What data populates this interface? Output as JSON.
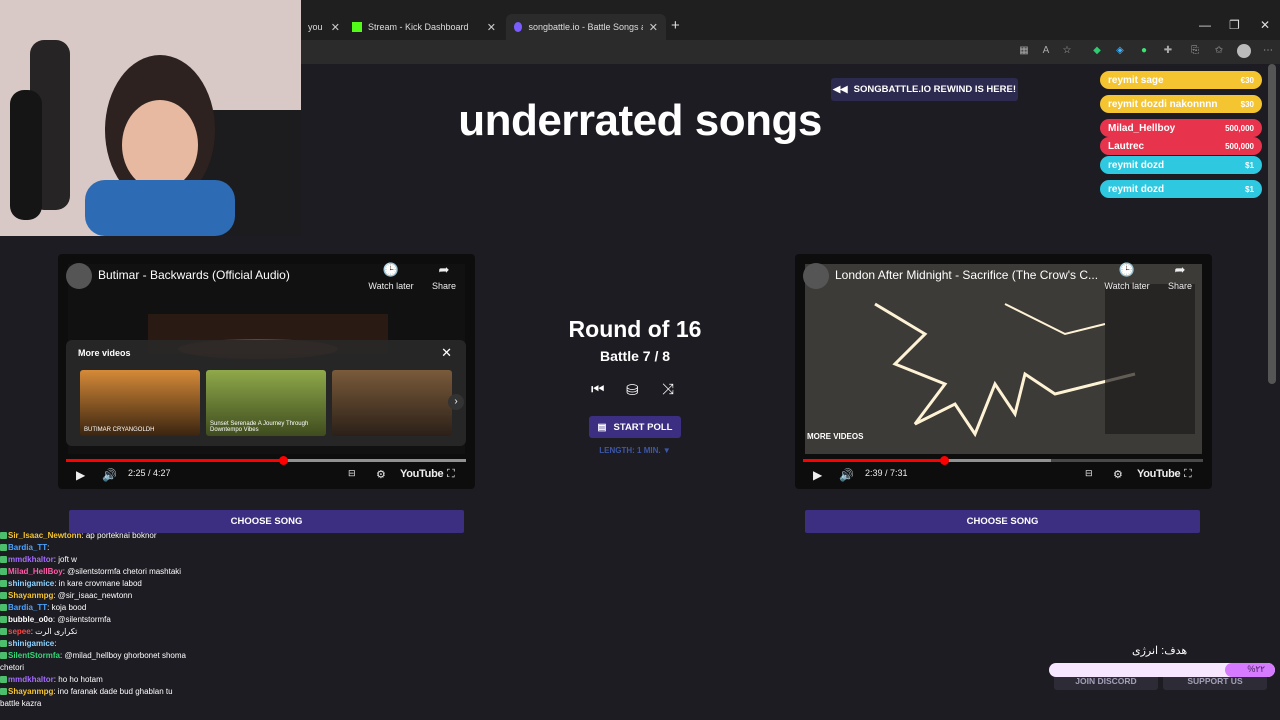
{
  "browser": {
    "tabs": [
      {
        "label": "you",
        "close": "✕"
      },
      {
        "label": "Stream - Kick Dashboard",
        "close": "✕"
      },
      {
        "label": "songbattle.io - Battle Songs again",
        "close": "✕"
      }
    ],
    "new_tab": "+"
  },
  "page": {
    "rewind_banner": "SONGBATTLE.IO REWIND IS HERE!",
    "title": "underrated songs",
    "round": "Round of 16",
    "battle": "Battle 7 / 8",
    "start_poll": "START POLL",
    "length": "LENGTH: 1 MIN. ▼",
    "left_video": {
      "title": "Butimar - Backwards (Official Audio)",
      "watch_later": "Watch later",
      "share": "Share",
      "more_videos": "More videos",
      "time": "2:25 / 4:27",
      "progress_fraction": 0.543,
      "thumb_captions": [
        "BUTIMAR CRYANGOLDH",
        "Sunset Serenade A Journey Through Downtempo Vibes",
        ""
      ]
    },
    "right_video": {
      "title": "London After Midnight - Sacrifice (The Crow's C...",
      "watch_later": "Watch later",
      "share": "Share",
      "more_videos": "MORE VIDEOS",
      "time": "2:39 / 7:31",
      "progress_fraction": 0.352
    },
    "youtube_label": "YouTube",
    "choose_song": "CHOOSE SONG"
  },
  "donations": [
    {
      "name": "reymit sage",
      "amount": "€30",
      "color": "#f5c431"
    },
    {
      "name": "reymit dozdi nakonnnn",
      "amount": "$30",
      "color": "#f5c431"
    },
    {
      "name": "Milad_Hellboy",
      "amount": "500,000",
      "color": "#e8334d"
    },
    {
      "name": "Lautrec",
      "amount": "500,000",
      "color": "#e8334d"
    },
    {
      "name": "reymit dozd",
      "amount": "$1",
      "color": "#2ec8e0"
    },
    {
      "name": "reymit dozd",
      "amount": "$1",
      "color": "#2ec8e0"
    }
  ],
  "chat": [
    {
      "name": "Sir_Isaac_Newtonn",
      "color": "#f5c431",
      "msg": "ap porteknai boknor"
    },
    {
      "name": "Bardia_TT",
      "color": "#4aa3ff",
      "msg": ""
    },
    {
      "name": "mmdkhaltor",
      "color": "#a46bff",
      "msg": "joft w"
    },
    {
      "name": "Milad_HellBoy",
      "color": "#ff5ca8",
      "msg": "@silentstormfa chetori mashtaki"
    },
    {
      "name": "",
      "color": "#ccc",
      "msg": ""
    },
    {
      "name": "shinigamice",
      "color": "#8fd3ff",
      "msg": "in kare crovmane labod"
    },
    {
      "name": "Shayanmpg",
      "color": "#f5c431",
      "msg": "@sir_isaac_newtonn"
    },
    {
      "name": "Bardia_TT",
      "color": "#4aa3ff",
      "msg": "koja bood"
    },
    {
      "name": "bubble_o0o",
      "color": "#ffffff",
      "msg": "@silentstormfa"
    },
    {
      "name": "sepee",
      "color": "#ff4444",
      "msg": "تکراری الرت"
    },
    {
      "name": "shinigamice",
      "color": "#8fd3ff",
      "msg": ""
    },
    {
      "name": "SilentStormfa",
      "color": "#37d67a",
      "msg": "@milad_hellboy ghorbonet shoma"
    },
    {
      "name": "",
      "color": "#fff",
      "msg": "chetori"
    },
    {
      "name": "mmdkhaltor",
      "color": "#a46bff",
      "msg": "ho ho hotam"
    },
    {
      "name": "Shayanmpg",
      "color": "#f5c431",
      "msg": "ino faranak dade bud ghablan tu"
    },
    {
      "name": "",
      "color": "#fff",
      "msg": "battle kazra"
    }
  ],
  "goal": {
    "label": "هدف: انرژی",
    "percent_text": "%۲۲",
    "fraction": 0.22
  },
  "footer": {
    "discord": "JOIN DISCORD",
    "support": "SUPPORT US"
  }
}
